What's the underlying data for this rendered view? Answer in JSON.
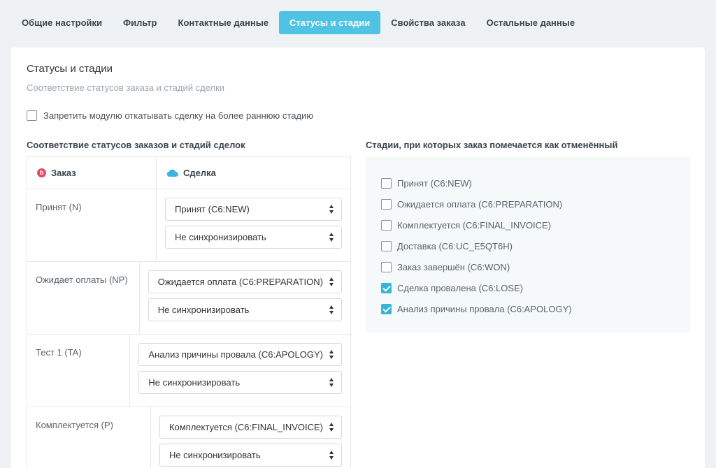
{
  "tabs": [
    {
      "label": "Общие настройки",
      "active": false
    },
    {
      "label": "Фильтр",
      "active": false
    },
    {
      "label": "Контактные данные",
      "active": false
    },
    {
      "label": "Статусы и стадии",
      "active": true
    },
    {
      "label": "Свойства заказа",
      "active": false
    },
    {
      "label": "Остальные данные",
      "active": false
    }
  ],
  "section": {
    "title": "Статусы и стадии",
    "subtitle": "Соответствие статусов заказа и стадий сделки",
    "forbid_label": "Запретить модулю откатывать сделку на более раннюю стадию",
    "forbid_checked": false
  },
  "mapping": {
    "heading": "Соответствие статусов заказов и стадий сделок",
    "col_order": "Заказ",
    "col_deal": "Сделка",
    "order_icon": "order-logo-icon",
    "deal_icon": "cloud-icon",
    "rows": [
      {
        "status": "Принят (N)",
        "stage": "Принят (C6:NEW)",
        "sync": "Не синхронизировать"
      },
      {
        "status": "Ожидает оплаты (NP)",
        "stage": "Ожидается оплата (C6:PREPARATION)",
        "sync": "Не синхронизировать"
      },
      {
        "status": "Тест 1 (TA)",
        "stage": "Анализ причины провала (C6:APOLOGY)",
        "sync": "Не синхронизировать"
      },
      {
        "status": "Комплектуется (P)",
        "stage": "Комплектуется (C6:FINAL_INVOICE)",
        "sync": "Не синхронизировать"
      }
    ]
  },
  "cancel": {
    "heading": "Стадии, при которых заказ помечается как отменённый",
    "items": [
      {
        "label": "Принят (C6:NEW)",
        "checked": false
      },
      {
        "label": "Ожидается оплата (C6:PREPARATION)",
        "checked": false
      },
      {
        "label": "Комплектуется (C6:FINAL_INVOICE)",
        "checked": false
      },
      {
        "label": "Доставка (C6:UC_E5QT6H)",
        "checked": false
      },
      {
        "label": "Заказ завершён (C6:WON)",
        "checked": false
      },
      {
        "label": "Сделка провалена (C6:LOSE)",
        "checked": true
      },
      {
        "label": "Анализ причины провала (C6:APOLOGY)",
        "checked": true
      }
    ]
  },
  "colors": {
    "accent": "#4fc3e4",
    "checkbox_checked": "#36b5db",
    "order_logo": "#e84a5f",
    "cloud": "#3fb3e0"
  }
}
